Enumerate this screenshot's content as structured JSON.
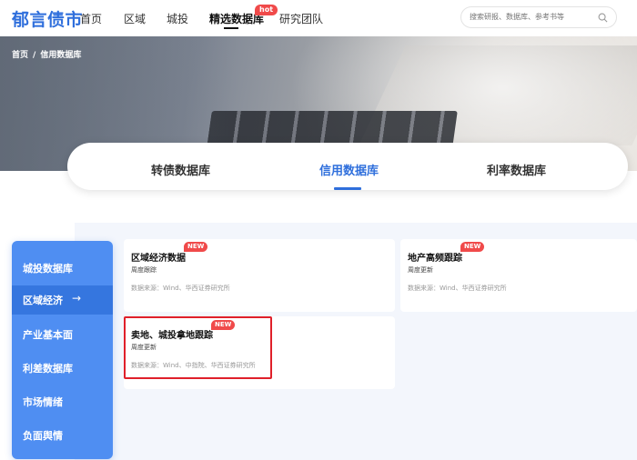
{
  "header": {
    "logo": "郁言债市",
    "nav": [
      "首页",
      "区域",
      "城投",
      "精选数据库",
      "研究团队"
    ],
    "hot_badge": "hot",
    "search_placeholder": "搜索研报、数据库、参考书等"
  },
  "breadcrumb": {
    "home": "首页",
    "sep": "/",
    "current": "信用数据库"
  },
  "tabs": [
    "转债数据库",
    "信用数据库",
    "利率数据库"
  ],
  "sidebar": {
    "items": [
      "城投数据库",
      "区域经济",
      "产业基本面",
      "利差数据库",
      "市场情绪",
      "负面舆情"
    ],
    "active_arrow": "→"
  },
  "cards": [
    {
      "title": "区域经济数据",
      "badge": "NEW",
      "freq": "周度跟踪",
      "source": "数据来源：Wind、华西证券研究所"
    },
    {
      "title": "地产高频跟踪",
      "badge": "NEW",
      "freq": "周度更新",
      "source": "数据来源：Wind、华西证券研究所"
    },
    {
      "title": "卖地、城投拿地跟踪",
      "badge": "NEW",
      "freq": "周度更新",
      "source": "数据来源：Wind、中指院、华西证券研究所"
    }
  ],
  "colors": {
    "accent": "#2f6fdc",
    "sidebar": "#4f8ef2",
    "badge": "#f04a4a",
    "highlight": "#e0202a"
  }
}
